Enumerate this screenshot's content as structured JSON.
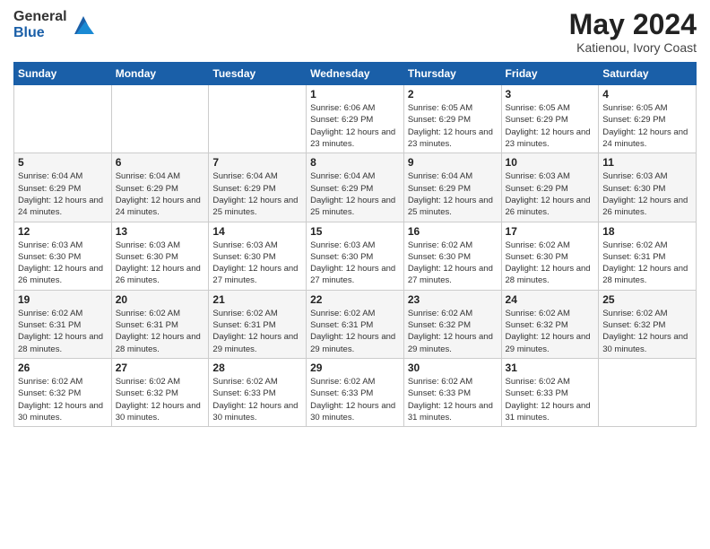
{
  "header": {
    "logo_general": "General",
    "logo_blue": "Blue",
    "month_year": "May 2024",
    "location": "Katienou, Ivory Coast"
  },
  "weekdays": [
    "Sunday",
    "Monday",
    "Tuesday",
    "Wednesday",
    "Thursday",
    "Friday",
    "Saturday"
  ],
  "weeks": [
    [
      {
        "day": "",
        "info": ""
      },
      {
        "day": "",
        "info": ""
      },
      {
        "day": "",
        "info": ""
      },
      {
        "day": "1",
        "info": "Sunrise: 6:06 AM\nSunset: 6:29 PM\nDaylight: 12 hours\nand 23 minutes."
      },
      {
        "day": "2",
        "info": "Sunrise: 6:05 AM\nSunset: 6:29 PM\nDaylight: 12 hours\nand 23 minutes."
      },
      {
        "day": "3",
        "info": "Sunrise: 6:05 AM\nSunset: 6:29 PM\nDaylight: 12 hours\nand 23 minutes."
      },
      {
        "day": "4",
        "info": "Sunrise: 6:05 AM\nSunset: 6:29 PM\nDaylight: 12 hours\nand 24 minutes."
      }
    ],
    [
      {
        "day": "5",
        "info": "Sunrise: 6:04 AM\nSunset: 6:29 PM\nDaylight: 12 hours\nand 24 minutes."
      },
      {
        "day": "6",
        "info": "Sunrise: 6:04 AM\nSunset: 6:29 PM\nDaylight: 12 hours\nand 24 minutes."
      },
      {
        "day": "7",
        "info": "Sunrise: 6:04 AM\nSunset: 6:29 PM\nDaylight: 12 hours\nand 25 minutes."
      },
      {
        "day": "8",
        "info": "Sunrise: 6:04 AM\nSunset: 6:29 PM\nDaylight: 12 hours\nand 25 minutes."
      },
      {
        "day": "9",
        "info": "Sunrise: 6:04 AM\nSunset: 6:29 PM\nDaylight: 12 hours\nand 25 minutes."
      },
      {
        "day": "10",
        "info": "Sunrise: 6:03 AM\nSunset: 6:29 PM\nDaylight: 12 hours\nand 26 minutes."
      },
      {
        "day": "11",
        "info": "Sunrise: 6:03 AM\nSunset: 6:30 PM\nDaylight: 12 hours\nand 26 minutes."
      }
    ],
    [
      {
        "day": "12",
        "info": "Sunrise: 6:03 AM\nSunset: 6:30 PM\nDaylight: 12 hours\nand 26 minutes."
      },
      {
        "day": "13",
        "info": "Sunrise: 6:03 AM\nSunset: 6:30 PM\nDaylight: 12 hours\nand 26 minutes."
      },
      {
        "day": "14",
        "info": "Sunrise: 6:03 AM\nSunset: 6:30 PM\nDaylight: 12 hours\nand 27 minutes."
      },
      {
        "day": "15",
        "info": "Sunrise: 6:03 AM\nSunset: 6:30 PM\nDaylight: 12 hours\nand 27 minutes."
      },
      {
        "day": "16",
        "info": "Sunrise: 6:02 AM\nSunset: 6:30 PM\nDaylight: 12 hours\nand 27 minutes."
      },
      {
        "day": "17",
        "info": "Sunrise: 6:02 AM\nSunset: 6:30 PM\nDaylight: 12 hours\nand 28 minutes."
      },
      {
        "day": "18",
        "info": "Sunrise: 6:02 AM\nSunset: 6:31 PM\nDaylight: 12 hours\nand 28 minutes."
      }
    ],
    [
      {
        "day": "19",
        "info": "Sunrise: 6:02 AM\nSunset: 6:31 PM\nDaylight: 12 hours\nand 28 minutes."
      },
      {
        "day": "20",
        "info": "Sunrise: 6:02 AM\nSunset: 6:31 PM\nDaylight: 12 hours\nand 28 minutes."
      },
      {
        "day": "21",
        "info": "Sunrise: 6:02 AM\nSunset: 6:31 PM\nDaylight: 12 hours\nand 29 minutes."
      },
      {
        "day": "22",
        "info": "Sunrise: 6:02 AM\nSunset: 6:31 PM\nDaylight: 12 hours\nand 29 minutes."
      },
      {
        "day": "23",
        "info": "Sunrise: 6:02 AM\nSunset: 6:32 PM\nDaylight: 12 hours\nand 29 minutes."
      },
      {
        "day": "24",
        "info": "Sunrise: 6:02 AM\nSunset: 6:32 PM\nDaylight: 12 hours\nand 29 minutes."
      },
      {
        "day": "25",
        "info": "Sunrise: 6:02 AM\nSunset: 6:32 PM\nDaylight: 12 hours\nand 30 minutes."
      }
    ],
    [
      {
        "day": "26",
        "info": "Sunrise: 6:02 AM\nSunset: 6:32 PM\nDaylight: 12 hours\nand 30 minutes."
      },
      {
        "day": "27",
        "info": "Sunrise: 6:02 AM\nSunset: 6:32 PM\nDaylight: 12 hours\nand 30 minutes."
      },
      {
        "day": "28",
        "info": "Sunrise: 6:02 AM\nSunset: 6:33 PM\nDaylight: 12 hours\nand 30 minutes."
      },
      {
        "day": "29",
        "info": "Sunrise: 6:02 AM\nSunset: 6:33 PM\nDaylight: 12 hours\nand 30 minutes."
      },
      {
        "day": "30",
        "info": "Sunrise: 6:02 AM\nSunset: 6:33 PM\nDaylight: 12 hours\nand 31 minutes."
      },
      {
        "day": "31",
        "info": "Sunrise: 6:02 AM\nSunset: 6:33 PM\nDaylight: 12 hours\nand 31 minutes."
      },
      {
        "day": "",
        "info": ""
      }
    ]
  ]
}
